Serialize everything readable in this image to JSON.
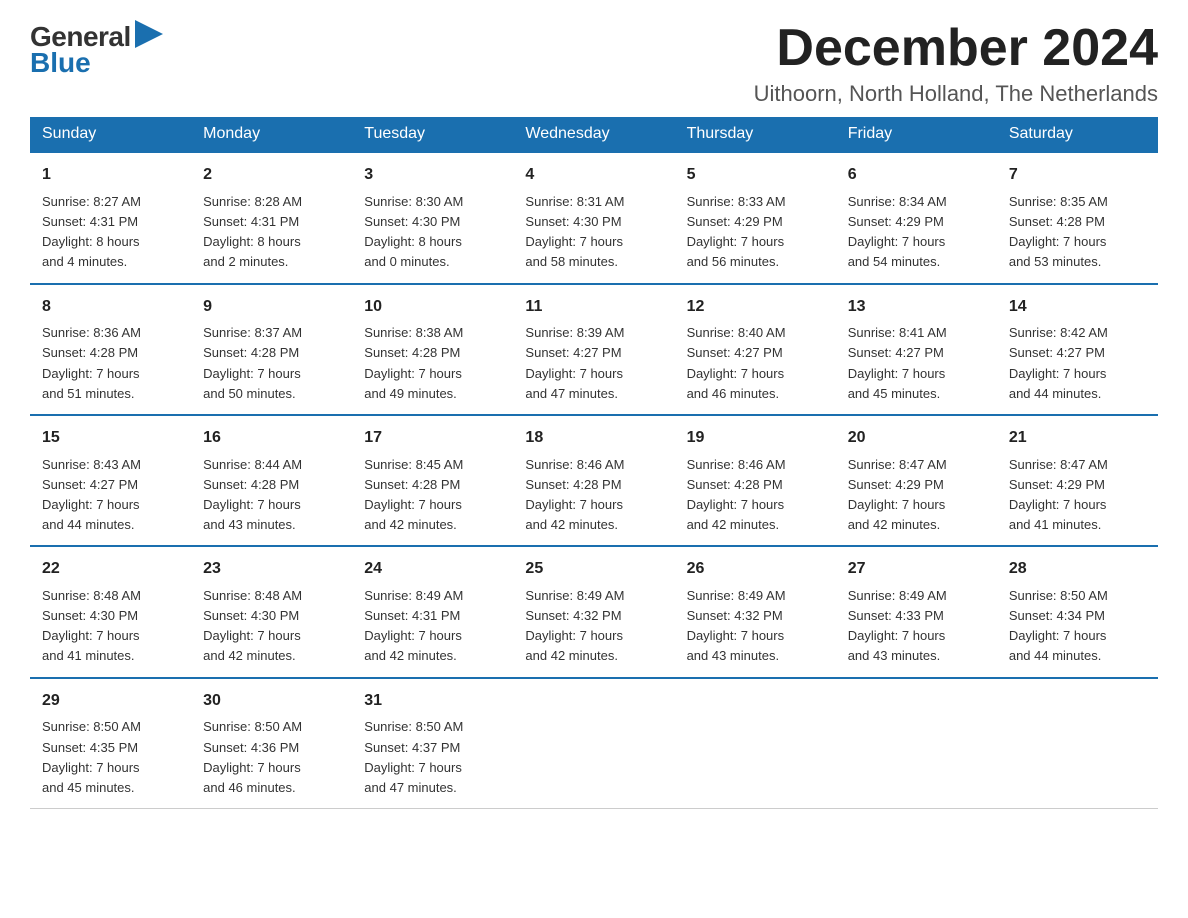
{
  "header": {
    "logo_general": "General",
    "logo_blue": "Blue",
    "month_title": "December 2024",
    "location": "Uithoorn, North Holland, The Netherlands"
  },
  "days_of_week": [
    "Sunday",
    "Monday",
    "Tuesday",
    "Wednesday",
    "Thursday",
    "Friday",
    "Saturday"
  ],
  "weeks": [
    [
      {
        "day": "1",
        "sunrise": "8:27 AM",
        "sunset": "4:31 PM",
        "daylight": "8 hours and 4 minutes."
      },
      {
        "day": "2",
        "sunrise": "8:28 AM",
        "sunset": "4:31 PM",
        "daylight": "8 hours and 2 minutes."
      },
      {
        "day": "3",
        "sunrise": "8:30 AM",
        "sunset": "4:30 PM",
        "daylight": "8 hours and 0 minutes."
      },
      {
        "day": "4",
        "sunrise": "8:31 AM",
        "sunset": "4:30 PM",
        "daylight": "7 hours and 58 minutes."
      },
      {
        "day": "5",
        "sunrise": "8:33 AM",
        "sunset": "4:29 PM",
        "daylight": "7 hours and 56 minutes."
      },
      {
        "day": "6",
        "sunrise": "8:34 AM",
        "sunset": "4:29 PM",
        "daylight": "7 hours and 54 minutes."
      },
      {
        "day": "7",
        "sunrise": "8:35 AM",
        "sunset": "4:28 PM",
        "daylight": "7 hours and 53 minutes."
      }
    ],
    [
      {
        "day": "8",
        "sunrise": "8:36 AM",
        "sunset": "4:28 PM",
        "daylight": "7 hours and 51 minutes."
      },
      {
        "day": "9",
        "sunrise": "8:37 AM",
        "sunset": "4:28 PM",
        "daylight": "7 hours and 50 minutes."
      },
      {
        "day": "10",
        "sunrise": "8:38 AM",
        "sunset": "4:28 PM",
        "daylight": "7 hours and 49 minutes."
      },
      {
        "day": "11",
        "sunrise": "8:39 AM",
        "sunset": "4:27 PM",
        "daylight": "7 hours and 47 minutes."
      },
      {
        "day": "12",
        "sunrise": "8:40 AM",
        "sunset": "4:27 PM",
        "daylight": "7 hours and 46 minutes."
      },
      {
        "day": "13",
        "sunrise": "8:41 AM",
        "sunset": "4:27 PM",
        "daylight": "7 hours and 45 minutes."
      },
      {
        "day": "14",
        "sunrise": "8:42 AM",
        "sunset": "4:27 PM",
        "daylight": "7 hours and 44 minutes."
      }
    ],
    [
      {
        "day": "15",
        "sunrise": "8:43 AM",
        "sunset": "4:27 PM",
        "daylight": "7 hours and 44 minutes."
      },
      {
        "day": "16",
        "sunrise": "8:44 AM",
        "sunset": "4:28 PM",
        "daylight": "7 hours and 43 minutes."
      },
      {
        "day": "17",
        "sunrise": "8:45 AM",
        "sunset": "4:28 PM",
        "daylight": "7 hours and 42 minutes."
      },
      {
        "day": "18",
        "sunrise": "8:46 AM",
        "sunset": "4:28 PM",
        "daylight": "7 hours and 42 minutes."
      },
      {
        "day": "19",
        "sunrise": "8:46 AM",
        "sunset": "4:28 PM",
        "daylight": "7 hours and 42 minutes."
      },
      {
        "day": "20",
        "sunrise": "8:47 AM",
        "sunset": "4:29 PM",
        "daylight": "7 hours and 42 minutes."
      },
      {
        "day": "21",
        "sunrise": "8:47 AM",
        "sunset": "4:29 PM",
        "daylight": "7 hours and 41 minutes."
      }
    ],
    [
      {
        "day": "22",
        "sunrise": "8:48 AM",
        "sunset": "4:30 PM",
        "daylight": "7 hours and 41 minutes."
      },
      {
        "day": "23",
        "sunrise": "8:48 AM",
        "sunset": "4:30 PM",
        "daylight": "7 hours and 42 minutes."
      },
      {
        "day": "24",
        "sunrise": "8:49 AM",
        "sunset": "4:31 PM",
        "daylight": "7 hours and 42 minutes."
      },
      {
        "day": "25",
        "sunrise": "8:49 AM",
        "sunset": "4:32 PM",
        "daylight": "7 hours and 42 minutes."
      },
      {
        "day": "26",
        "sunrise": "8:49 AM",
        "sunset": "4:32 PM",
        "daylight": "7 hours and 43 minutes."
      },
      {
        "day": "27",
        "sunrise": "8:49 AM",
        "sunset": "4:33 PM",
        "daylight": "7 hours and 43 minutes."
      },
      {
        "day": "28",
        "sunrise": "8:50 AM",
        "sunset": "4:34 PM",
        "daylight": "7 hours and 44 minutes."
      }
    ],
    [
      {
        "day": "29",
        "sunrise": "8:50 AM",
        "sunset": "4:35 PM",
        "daylight": "7 hours and 45 minutes."
      },
      {
        "day": "30",
        "sunrise": "8:50 AM",
        "sunset": "4:36 PM",
        "daylight": "7 hours and 46 minutes."
      },
      {
        "day": "31",
        "sunrise": "8:50 AM",
        "sunset": "4:37 PM",
        "daylight": "7 hours and 47 minutes."
      },
      null,
      null,
      null,
      null
    ]
  ],
  "labels": {
    "sunrise": "Sunrise:",
    "sunset": "Sunset:",
    "daylight": "Daylight:"
  }
}
